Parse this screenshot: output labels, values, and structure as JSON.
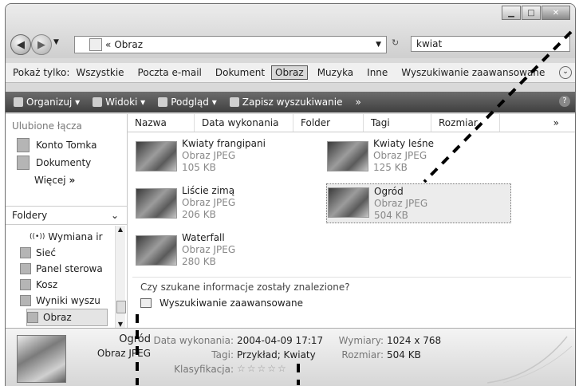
{
  "address": {
    "path_prefix": "«",
    "path": "Obraz"
  },
  "search": {
    "value": "kwiat"
  },
  "filter": {
    "label": "Pokaż tylko:",
    "options": [
      "Wszystkie",
      "Poczta e-mail",
      "Dokument",
      "Obraz",
      "Muzyka",
      "Inne",
      "Wyszukiwanie zaawansowane"
    ],
    "selected": "Obraz"
  },
  "toolbar": {
    "organize": "Organizuj",
    "views": "Widoki",
    "preview": "Podgląd",
    "save_search": "Zapisz wyszukiwanie",
    "more": "»",
    "help": "?"
  },
  "left": {
    "favorites_header": "Ulubione łącza",
    "favorites": [
      "Konto Tomka",
      "Dokumenty"
    ],
    "more": "Więcej",
    "more_glyph": "»",
    "folders_label": "Foldery",
    "tree": [
      "Wymiana ir",
      "Sieć",
      "Panel sterowa",
      "Kosz",
      "Wyniki wyszu",
      "Obraz"
    ]
  },
  "columns": [
    "Nazwa",
    "Data wykonania",
    "Folder",
    "Tagi",
    "Rozmiar",
    "»"
  ],
  "files": [
    {
      "name": "Kwiaty frangipani",
      "type": "Obraz JPEG",
      "size": "105 KB"
    },
    {
      "name": "Kwiaty leśne",
      "type": "Obraz JPEG",
      "size": "125 KB"
    },
    {
      "name": "Liście zimą",
      "type": "Obraz JPEG",
      "size": "206 KB"
    },
    {
      "name": "Ogród",
      "type": "Obraz JPEG",
      "size": "504 KB"
    },
    {
      "name": "Waterfall",
      "type": "Obraz JPEG",
      "size": "280 KB"
    }
  ],
  "found_question": "Czy szukane informacje zostały znalezione?",
  "advanced_search": "Wyszukiwanie zaawansowane",
  "details": {
    "name": "Ogród",
    "type": "Obraz JPEG",
    "date_label": "Data wykonania:",
    "date_value": "2004-04-09 17:17",
    "tags_label": "Tagi:",
    "tags_value": "Przykład; Kwiaty",
    "rating_label": "Klasyfikacja:",
    "rating_stars": "☆☆☆☆☆",
    "rating_value": 0,
    "dims_label": "Wymiary:",
    "dims_value": "1024 x 768",
    "size_label": "Rozmiar:",
    "size_value": "504 KB"
  }
}
